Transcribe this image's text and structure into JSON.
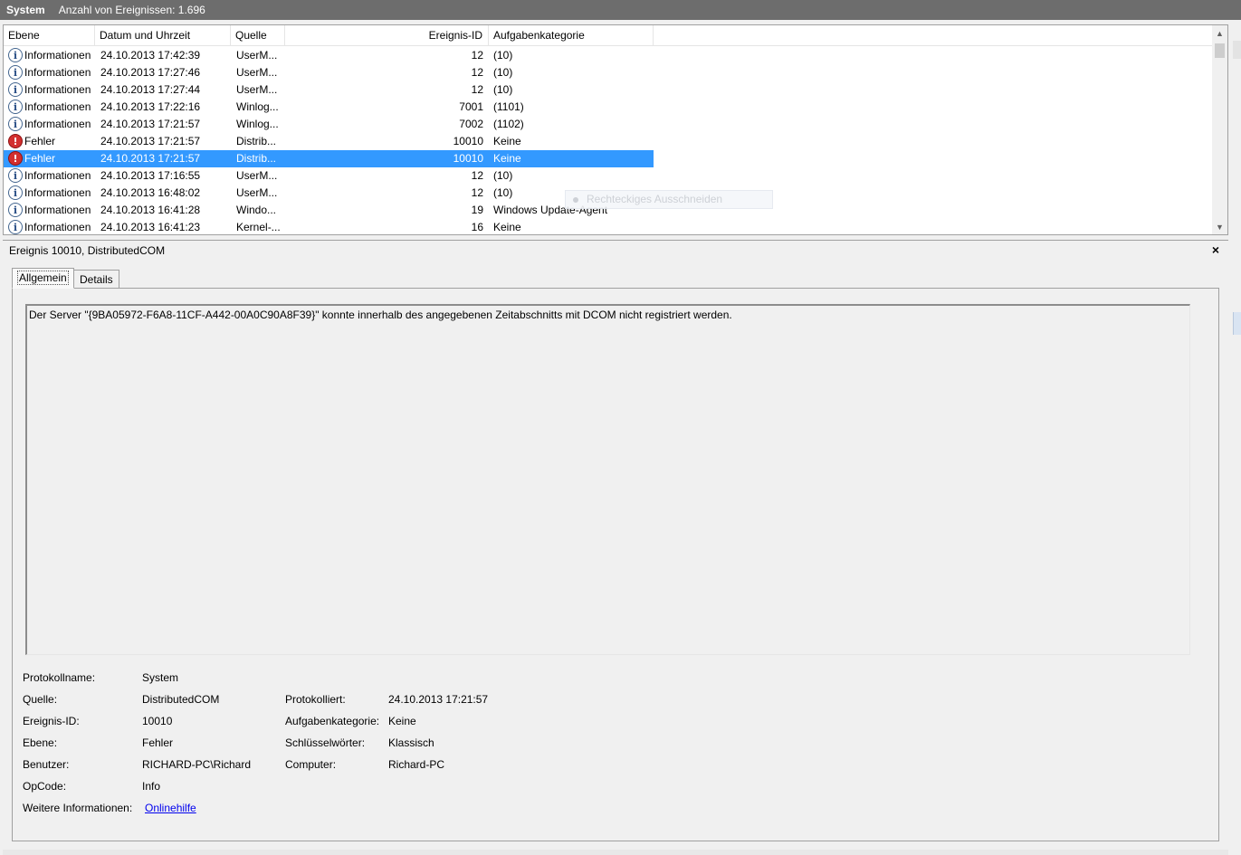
{
  "titlebar": {
    "log_name": "System",
    "event_count": "Anzahl von Ereignissen: 1.696"
  },
  "columns": {
    "level": "Ebene",
    "datetime": "Datum und Uhrzeit",
    "source": "Quelle",
    "event_id": "Ereignis-ID",
    "task_category": "Aufgabenkategorie"
  },
  "events": [
    {
      "icon": "info-icon",
      "level": "Informationen",
      "datetime": "24.10.2013 17:42:39",
      "source": "UserM...",
      "event_id": "12",
      "task_category": "(10)",
      "selected": false
    },
    {
      "icon": "info-icon",
      "level": "Informationen",
      "datetime": "24.10.2013 17:27:46",
      "source": "UserM...",
      "event_id": "12",
      "task_category": "(10)",
      "selected": false
    },
    {
      "icon": "info-icon",
      "level": "Informationen",
      "datetime": "24.10.2013 17:27:44",
      "source": "UserM...",
      "event_id": "12",
      "task_category": "(10)",
      "selected": false
    },
    {
      "icon": "info-icon",
      "level": "Informationen",
      "datetime": "24.10.2013 17:22:16",
      "source": "Winlog...",
      "event_id": "7001",
      "task_category": "(1101)",
      "selected": false
    },
    {
      "icon": "info-icon",
      "level": "Informationen",
      "datetime": "24.10.2013 17:21:57",
      "source": "Winlog...",
      "event_id": "7002",
      "task_category": "(1102)",
      "selected": false
    },
    {
      "icon": "error-icon",
      "level": "Fehler",
      "datetime": "24.10.2013 17:21:57",
      "source": "Distrib...",
      "event_id": "10010",
      "task_category": "Keine",
      "selected": false
    },
    {
      "icon": "error-icon",
      "level": "Fehler",
      "datetime": "24.10.2013 17:21:57",
      "source": "Distrib...",
      "event_id": "10010",
      "task_category": "Keine",
      "selected": true
    },
    {
      "icon": "info-icon",
      "level": "Informationen",
      "datetime": "24.10.2013 17:16:55",
      "source": "UserM...",
      "event_id": "12",
      "task_category": "(10)",
      "selected": false
    },
    {
      "icon": "info-icon",
      "level": "Informationen",
      "datetime": "24.10.2013 16:48:02",
      "source": "UserM...",
      "event_id": "12",
      "task_category": "(10)",
      "selected": false
    },
    {
      "icon": "info-icon",
      "level": "Informationen",
      "datetime": "24.10.2013 16:41:28",
      "source": "Windo...",
      "event_id": "19",
      "task_category": "Windows Update-Agent",
      "selected": false
    },
    {
      "icon": "info-icon",
      "level": "Informationen",
      "datetime": "24.10.2013 16:41:23",
      "source": "Kernel-...",
      "event_id": "16",
      "task_category": "Keine",
      "selected": false
    }
  ],
  "ghost_tooltip": "Rechteckiges Ausschneiden",
  "detail": {
    "title": "Ereignis 10010, DistributedCOM",
    "close": "×",
    "tabs": [
      "Allgemein",
      "Details"
    ],
    "message": "Der Server \"{9BA05972-F6A8-11CF-A442-00A0C90A8F39}\" konnte innerhalb des angegebenen Zeitabschnitts mit DCOM nicht registriert werden.",
    "props": {
      "logname_label": "Protokollname:",
      "logname": "System",
      "source_label": "Quelle:",
      "source": "DistributedCOM",
      "logged_label": "Protokolliert:",
      "logged": "24.10.2013 17:21:57",
      "eventid_label": "Ereignis-ID:",
      "eventid": "10010",
      "taskcat_label": "Aufgabenkategorie:",
      "taskcat": "Keine",
      "level_label": "Ebene:",
      "level": "Fehler",
      "keywords_label": "Schlüsselwörter:",
      "keywords": "Klassisch",
      "user_label": "Benutzer:",
      "user": "RICHARD-PC\\Richard",
      "computer_label": "Computer:",
      "computer": "Richard-PC",
      "opcode_label": "OpCode:",
      "opcode": "Info",
      "moreinfo_label": "Weitere Informationen:",
      "moreinfo": "Onlinehilfe"
    }
  },
  "colors": {
    "titlebar": "#6d6d6d",
    "selection": "#3399ff",
    "error": "#d32f2f",
    "link": "#0000ee"
  }
}
